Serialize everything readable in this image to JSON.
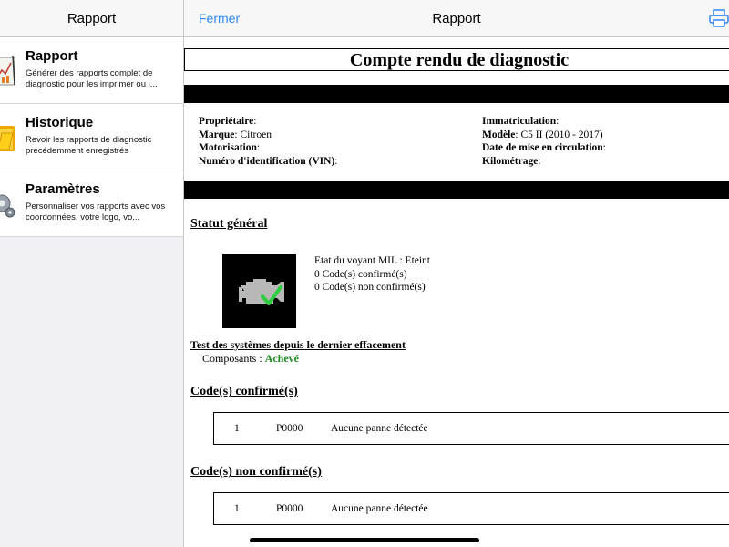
{
  "sidebar": {
    "title": "Rapport",
    "items": [
      {
        "title": "Rapport",
        "desc": "Générer des rapports complet de diagnostic pour les imprimer ou l...",
        "icon": "report-chart-icon"
      },
      {
        "title": "Historique",
        "desc": "Revoir les rapports de diagnostic précédemment enregistrés",
        "icon": "history-folder-icon"
      },
      {
        "title": "Paramètres",
        "desc": "Personnaliser vos rapports avec vos coordonnées, votre logo, vo...",
        "icon": "settings-gear-icon"
      }
    ]
  },
  "nav": {
    "close_label": "Fermer",
    "title": "Rapport",
    "print_icon": "print-icon"
  },
  "doc": {
    "title": "Compte rendu de diagnostic",
    "left_fields": [
      {
        "label": "Propriétaire",
        "value": ""
      },
      {
        "label": "Marque",
        "value": " Citroen"
      },
      {
        "label": "Motorisation",
        "value": ""
      },
      {
        "label": "Numéro d'identification (VIN)",
        "value": ""
      }
    ],
    "right_fields": [
      {
        "label": "Immatriculation",
        "value": ""
      },
      {
        "label": "Modèle",
        "value": " C5 II (2010 - 2017)"
      },
      {
        "label": "Date de mise en circulation",
        "value": ""
      },
      {
        "label": "Kilométrage",
        "value": ""
      }
    ],
    "general_status_heading": "Statut général",
    "engine_icon": "check-engine-ok-icon",
    "mil_lines": [
      "Etat du voyant MIL : Eteint",
      "0 Code(s) confirmé(s)",
      "0 Code(s) non confirmé(s)"
    ],
    "tests_heading": "Test des systèmes depuis le dernier effacement",
    "components_label": "Composants : ",
    "components_status": "Achevé",
    "confirmed_heading": "Code(s) confirmé(s)",
    "confirmed_row": {
      "num": "1",
      "code": "P0000",
      "desc": "Aucune panne détectée"
    },
    "unconfirmed_heading": "Code(s) non confirmé(s)",
    "unconfirmed_row": {
      "num": "1",
      "code": "P0000",
      "desc": "Aucune panne détectée"
    }
  }
}
